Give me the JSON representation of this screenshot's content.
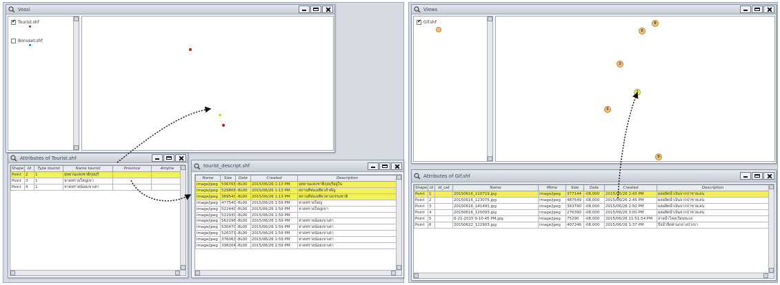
{
  "left_map_window": {
    "title": "Vossi",
    "layers": [
      {
        "label": "Tourist.shf",
        "checked": true
      },
      {
        "label": "Bonuset.shf",
        "checked": false
      }
    ]
  },
  "attr_window": {
    "title": "Attributes of Tourist.shf",
    "columns": [
      "Shape",
      "Id",
      "Type tourist",
      "Name tourist",
      "Province",
      "Amphe"
    ],
    "rows": [
      [
        "Point",
        "2",
        "1",
        "อุทยานแห่งชาติกุยบุรี",
        "",
        ""
      ],
      [
        "Point",
        "3",
        "1",
        "หาดทรายใหญ่เขา",
        "",
        ""
      ],
      [
        "Point",
        "4",
        "1",
        "หาดทรายน้อยเขาเต่า",
        "",
        ""
      ]
    ]
  },
  "photo_window": {
    "title": "tourist_descript.shf",
    "columns": [
      "Name",
      "Size",
      "Date",
      "Created",
      "Description"
    ],
    "rows": [
      [
        "image/jpeg",
        "536765",
        "-8L00",
        "2015/06/26 1:13 PM",
        "อุทยานแห่งชาติกุยบุรีอยู่ใน"
      ],
      [
        "image/jpeg",
        "529806",
        "-8L00",
        "2015/06/26 1:13 PM",
        "สถานที่ท่องเที่ยวสำคัญ"
      ],
      [
        "image/jpeg",
        "369540",
        "-8L00",
        "2015/06/26 1:13 PM",
        "สถานที่ท่องเที่ยวทางธรรมชาติ"
      ],
      [
        "image/jpeg",
        "477540",
        "-8L00",
        "2015/06/26 1:59 PM",
        "หาดทรายใหญ่"
      ],
      [
        "image/jpeg",
        "522440",
        "-8L00",
        "2015/06/26 1:59 PM",
        "หาดทรายใหญ่เขา"
      ],
      [
        "image/jpeg",
        "522930",
        "-8L00",
        "2015/06/26 1:59 PM",
        ""
      ],
      [
        "image/jpeg",
        "562196",
        "-8L00",
        "2015/06/26 1:59 PM",
        "หาดทรายน้อยเขาเต่า"
      ],
      [
        "image/jpeg",
        "530470",
        "-8L00",
        "2015/06/26 1:59 PM",
        "หาดทรายน้อยเขาเต่า"
      ],
      [
        "image/jpeg",
        "526371",
        "-8L00",
        "2015/06/26 1:59 PM",
        "หาดทรายน้อยเขาเต่า"
      ],
      [
        "image/jpeg",
        "376063",
        "-8L00",
        "2015/06/26 1:59 PM",
        "หาดทรายน้อยเขาเต่า"
      ],
      [
        "image/jpeg",
        "398204",
        "-8L00",
        "2015/06/26 1:59 PM",
        "หาดทรายน้อยเขาเต่า"
      ]
    ]
  },
  "right_map_window": {
    "title": "Views",
    "layers": [
      {
        "label": "Gif.shf",
        "checked": true
      }
    ],
    "markers": [
      "8",
      "6",
      "3",
      "2",
      "5",
      "9"
    ]
  },
  "right_attr_window": {
    "title": "Attributes of Gif.shf",
    "columns": [
      "Shape",
      "Id",
      "Id_cat",
      "Name",
      "Mime",
      "Size",
      "Date",
      "Created",
      "Description"
    ],
    "rows": [
      [
        "Point",
        "1",
        "",
        "20150616_110719.jpg",
        "image/jpeg",
        "377144",
        "-08,000",
        "2015/06/26 2:43 PM",
        "ผลผลิตน้ำเงินจากป่าชายเลน"
      ],
      [
        "Point",
        "2",
        "",
        "20150616_123075.jpg",
        "image/jpeg",
        "487549",
        "-08,000",
        "2015/06/26 2:45 PM",
        "ผลผลิตน้ำเงินจากป่าชายเลน"
      ],
      [
        "Point",
        "3",
        "",
        "20150616_141491.jpg",
        "image/jpeg",
        "363790",
        "-08,000",
        "2015/06/26 2:50 PM",
        "ผลผลิตน้ำเงินจากป่าชายเลน"
      ],
      [
        "Point",
        "4",
        "",
        "20150616_120093.jpg",
        "image/jpeg",
        "276390",
        "-08,000",
        "2015/06/26 3:00 PM",
        "ผลผลิตน้ำเงินจากป่าชายเลน"
      ],
      [
        "Point",
        "5",
        "",
        "6-21-2015 9-10-45 PM.jpg",
        "image/jpeg",
        "75290",
        "-08,000",
        "2015/06/26 11:51:54 PM",
        "สายน้ำไหลเวียนทะเล"
      ],
      [
        "Point",
        "6",
        "",
        "20150622_122903.jpg",
        "image/jpeg",
        "407246",
        "-08,000",
        "2015/06/26 1:37 PM",
        "บึงน้ำจืดท่ามกลางป่าเขา"
      ]
    ]
  }
}
